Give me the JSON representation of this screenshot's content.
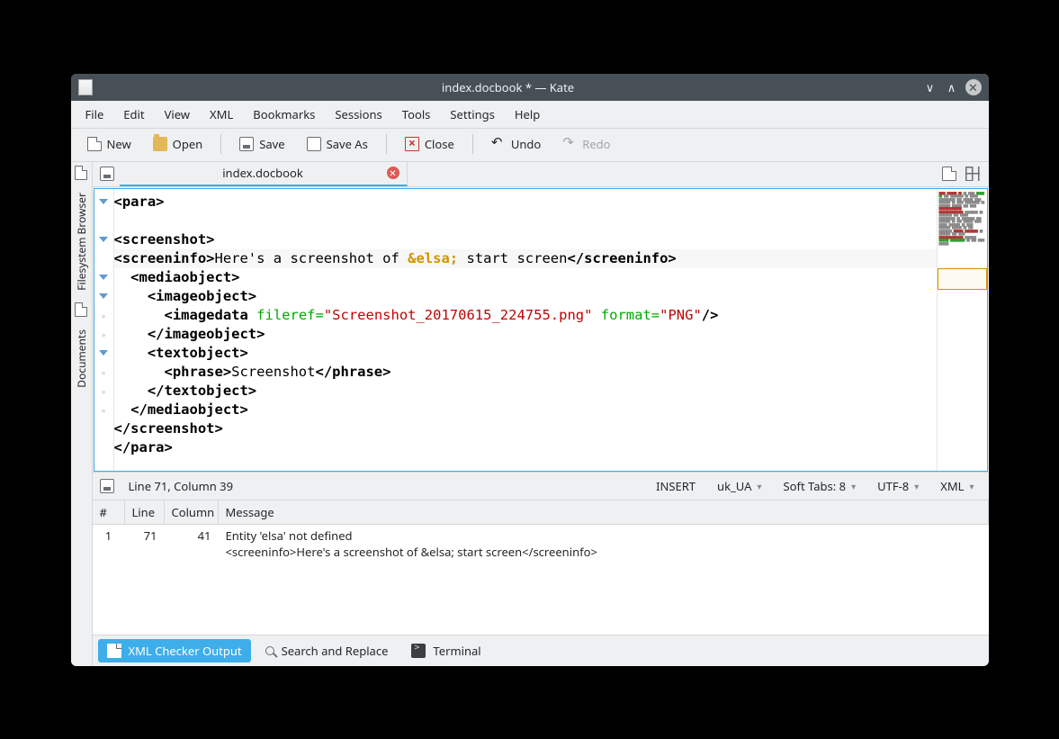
{
  "window": {
    "title": "index.docbook * — Kate"
  },
  "menubar": [
    "File",
    "Edit",
    "View",
    "XML",
    "Bookmarks",
    "Sessions",
    "Tools",
    "Settings",
    "Help"
  ],
  "toolbar": {
    "new": "New",
    "open": "Open",
    "save": "Save",
    "saveas": "Save As",
    "close": "Close",
    "undo": "Undo",
    "redo": "Redo"
  },
  "sidebar": {
    "fs": "Filesystem Browser",
    "docs": "Documents"
  },
  "tab": {
    "label": "index.docbook"
  },
  "code_lines": [
    {
      "fold": "tri",
      "spans": [
        {
          "c": "tag",
          "t": "<para>"
        }
      ]
    },
    {
      "fold": "",
      "spans": []
    },
    {
      "fold": "tri",
      "spans": [
        {
          "c": "tag",
          "t": "<screenshot>"
        }
      ]
    },
    {
      "fold": "",
      "hl": true,
      "spans": [
        {
          "c": "tag",
          "t": "<screeninfo>"
        },
        {
          "c": "txt",
          "t": "Here's a screenshot of "
        },
        {
          "c": "entity",
          "t": "&elsa;"
        },
        {
          "c": "txt",
          "t": " start screen"
        },
        {
          "c": "tag",
          "t": "</screeninfo>"
        }
      ]
    },
    {
      "fold": "tri",
      "spans": [
        {
          "c": "txt",
          "t": "  "
        },
        {
          "c": "tag",
          "t": "<mediaobject>"
        }
      ]
    },
    {
      "fold": "tri",
      "spans": [
        {
          "c": "txt",
          "t": "    "
        },
        {
          "c": "tag",
          "t": "<imageobject>"
        }
      ]
    },
    {
      "fold": "dot",
      "spans": [
        {
          "c": "txt",
          "t": "      "
        },
        {
          "c": "tag",
          "t": "<imagedata"
        },
        {
          "c": "txt",
          "t": " "
        },
        {
          "c": "attr",
          "t": "fileref="
        },
        {
          "c": "str",
          "t": "\"Screenshot_20170615_224755.png\""
        },
        {
          "c": "txt",
          "t": " "
        },
        {
          "c": "attr",
          "t": "format="
        },
        {
          "c": "str",
          "t": "\"PNG\""
        },
        {
          "c": "tag",
          "t": "/>"
        }
      ]
    },
    {
      "fold": "dot",
      "spans": [
        {
          "c": "txt",
          "t": "    "
        },
        {
          "c": "tag",
          "t": "</imageobject>"
        }
      ]
    },
    {
      "fold": "tri",
      "spans": [
        {
          "c": "txt",
          "t": "    "
        },
        {
          "c": "tag",
          "t": "<textobject>"
        }
      ]
    },
    {
      "fold": "dot",
      "spans": [
        {
          "c": "txt",
          "t": "      "
        },
        {
          "c": "tag",
          "t": "<phrase>"
        },
        {
          "c": "txt",
          "t": "Screenshot"
        },
        {
          "c": "tag",
          "t": "</phrase>"
        }
      ]
    },
    {
      "fold": "dot",
      "spans": [
        {
          "c": "txt",
          "t": "    "
        },
        {
          "c": "tag",
          "t": "</textobject>"
        }
      ]
    },
    {
      "fold": "dot",
      "spans": [
        {
          "c": "txt",
          "t": "  "
        },
        {
          "c": "tag",
          "t": "</mediaobject>"
        }
      ]
    },
    {
      "fold": "",
      "spans": [
        {
          "c": "tag",
          "t": "</screenshot>"
        }
      ]
    },
    {
      "fold": "",
      "spans": [
        {
          "c": "tag",
          "t": "</para>"
        }
      ]
    }
  ],
  "status": {
    "position": "Line 71, Column 39",
    "mode": "INSERT",
    "locale": "uk_UA",
    "indent": "Soft Tabs: 8",
    "encoding": "UTF-8",
    "lang": "XML"
  },
  "msg_headers": {
    "n": "#",
    "line": "Line",
    "col": "Column",
    "msg": "Message"
  },
  "messages": [
    {
      "n": "1",
      "line": "71",
      "col": "41",
      "msg1": "Entity 'elsa' not defined",
      "msg2": "<screeninfo>Here's a screenshot of &elsa; start screen</screeninfo>"
    }
  ],
  "bottom": {
    "xml": "XML Checker Output",
    "search": "Search and Replace",
    "term": "Terminal"
  }
}
